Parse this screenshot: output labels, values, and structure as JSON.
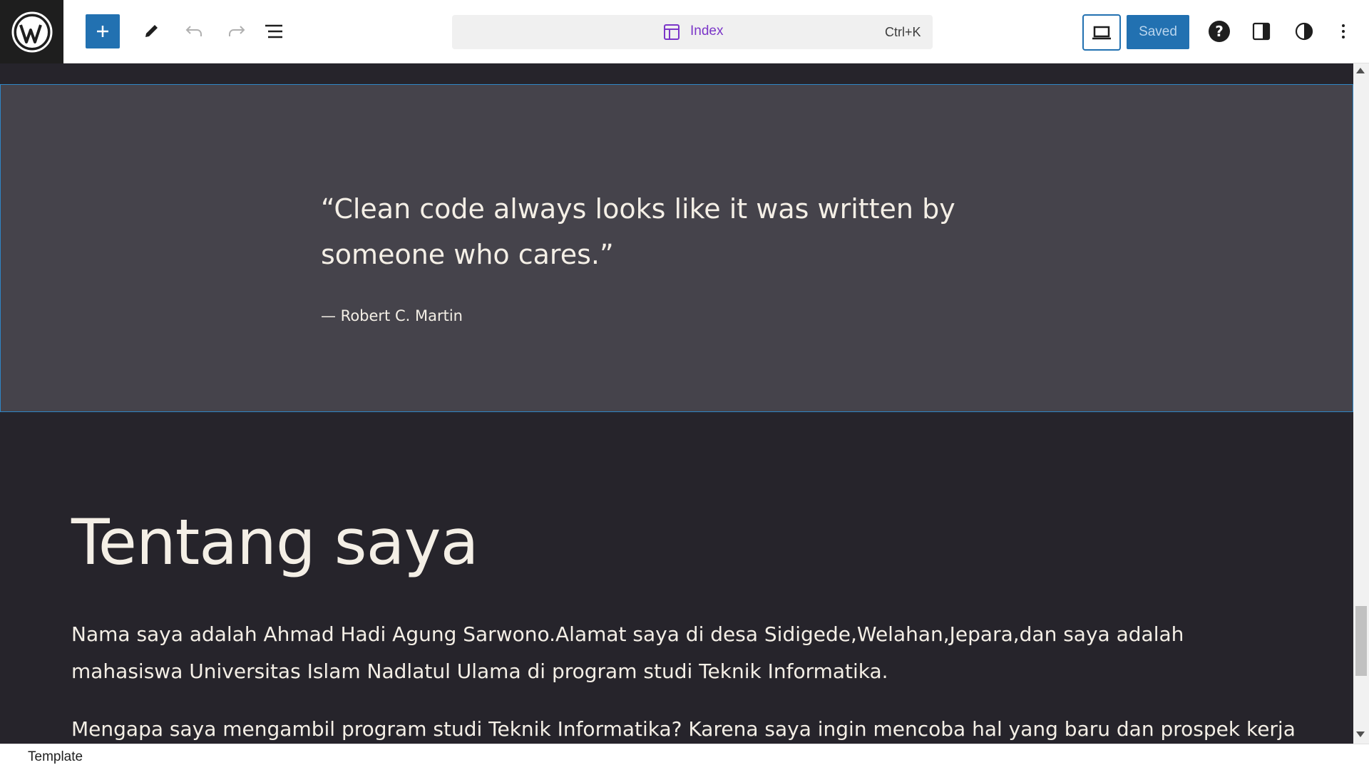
{
  "toolbar": {
    "logo_icon": "wordpress-logo-icon",
    "add_icon": "plus-icon",
    "edit_icon": "pencil-icon",
    "undo_icon": "undo-icon",
    "redo_icon": "redo-icon",
    "list_view_icon": "list-view-icon",
    "command": {
      "icon": "layout-icon",
      "title": "Index",
      "shortcut": "Ctrl+K"
    },
    "preview_icon": "desktop-icon",
    "save_label": "Saved",
    "help_icon": "help-icon",
    "settings_icon": "sidebar-icon",
    "styles_icon": "contrast-icon",
    "options_icon": "more-vertical-icon",
    "accent_color": "#2271b1",
    "command_color": "#7b36c8"
  },
  "canvas": {
    "quote": {
      "text": "“Clean code always looks like it was written by someone who cares.”",
      "cite": "— Robert C. Martin"
    },
    "about": {
      "heading": "Tentang saya",
      "paragraph1": "Nama saya adalah Ahmad Hadi Agung Sarwono.Alamat saya di desa Sidigede,Welahan,Jepara,dan saya adalah mahasiswa Universitas Islam Nadlatul Ulama di program studi Teknik Informatika.",
      "paragraph2": "Mengapa saya mengambil program studi Teknik Informatika? Karena saya ingin mencoba hal yang baru dan prospek kerja"
    },
    "colors": {
      "background": "#26242b",
      "quote_background": "#45434b",
      "text": "#f4efe6",
      "selection": "#2f86c6"
    }
  },
  "footer": {
    "breadcrumb": "Template"
  }
}
